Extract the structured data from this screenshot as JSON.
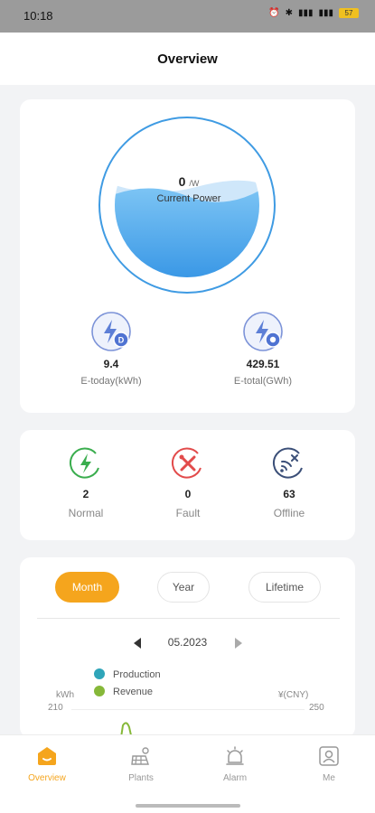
{
  "status_bar": {
    "time": "10:18",
    "battery": "57"
  },
  "header": {
    "title": "Overview"
  },
  "power": {
    "current_value": "0",
    "current_unit": "/W",
    "current_label": "Current Power",
    "fill_level": 0.6,
    "e_today_value": "9.4",
    "e_today_label": "E-today(kWh)",
    "e_total_value": "429.51",
    "e_total_label": "E-total(GWh)"
  },
  "status": {
    "normal_value": "2",
    "normal_label": "Normal",
    "fault_value": "0",
    "fault_label": "Fault",
    "offline_value": "63",
    "offline_label": "Offline"
  },
  "chart": {
    "tabs": {
      "month": "Month",
      "year": "Year",
      "lifetime": "Lifetime"
    },
    "active_tab": "Month",
    "period": "05.2023",
    "legend": {
      "production": "Production",
      "revenue": "Revenue"
    },
    "left_unit": "kWh",
    "left_max": "210",
    "right_unit": "¥(CNY)",
    "right_max": "250"
  },
  "nav": {
    "overview": "Overview",
    "plants": "Plants",
    "alarm": "Alarm",
    "me": "Me"
  },
  "colors": {
    "accent": "#f5a51d",
    "water": "#4aa6ea",
    "production": "#2fa5b9",
    "revenue": "#86b839",
    "normal": "#3aad4e",
    "fault": "#e24b4b",
    "offline": "#3b4f78"
  },
  "icons": {
    "e_today": "lightning-day-icon",
    "e_total": "lightning-total-icon",
    "normal": "lightning-circle-icon",
    "fault": "fault-tools-icon",
    "offline": "signal-off-icon",
    "overview": "home-icon",
    "plants": "solar-plant-icon",
    "alarm": "alarm-bell-icon",
    "me": "user-icon"
  }
}
